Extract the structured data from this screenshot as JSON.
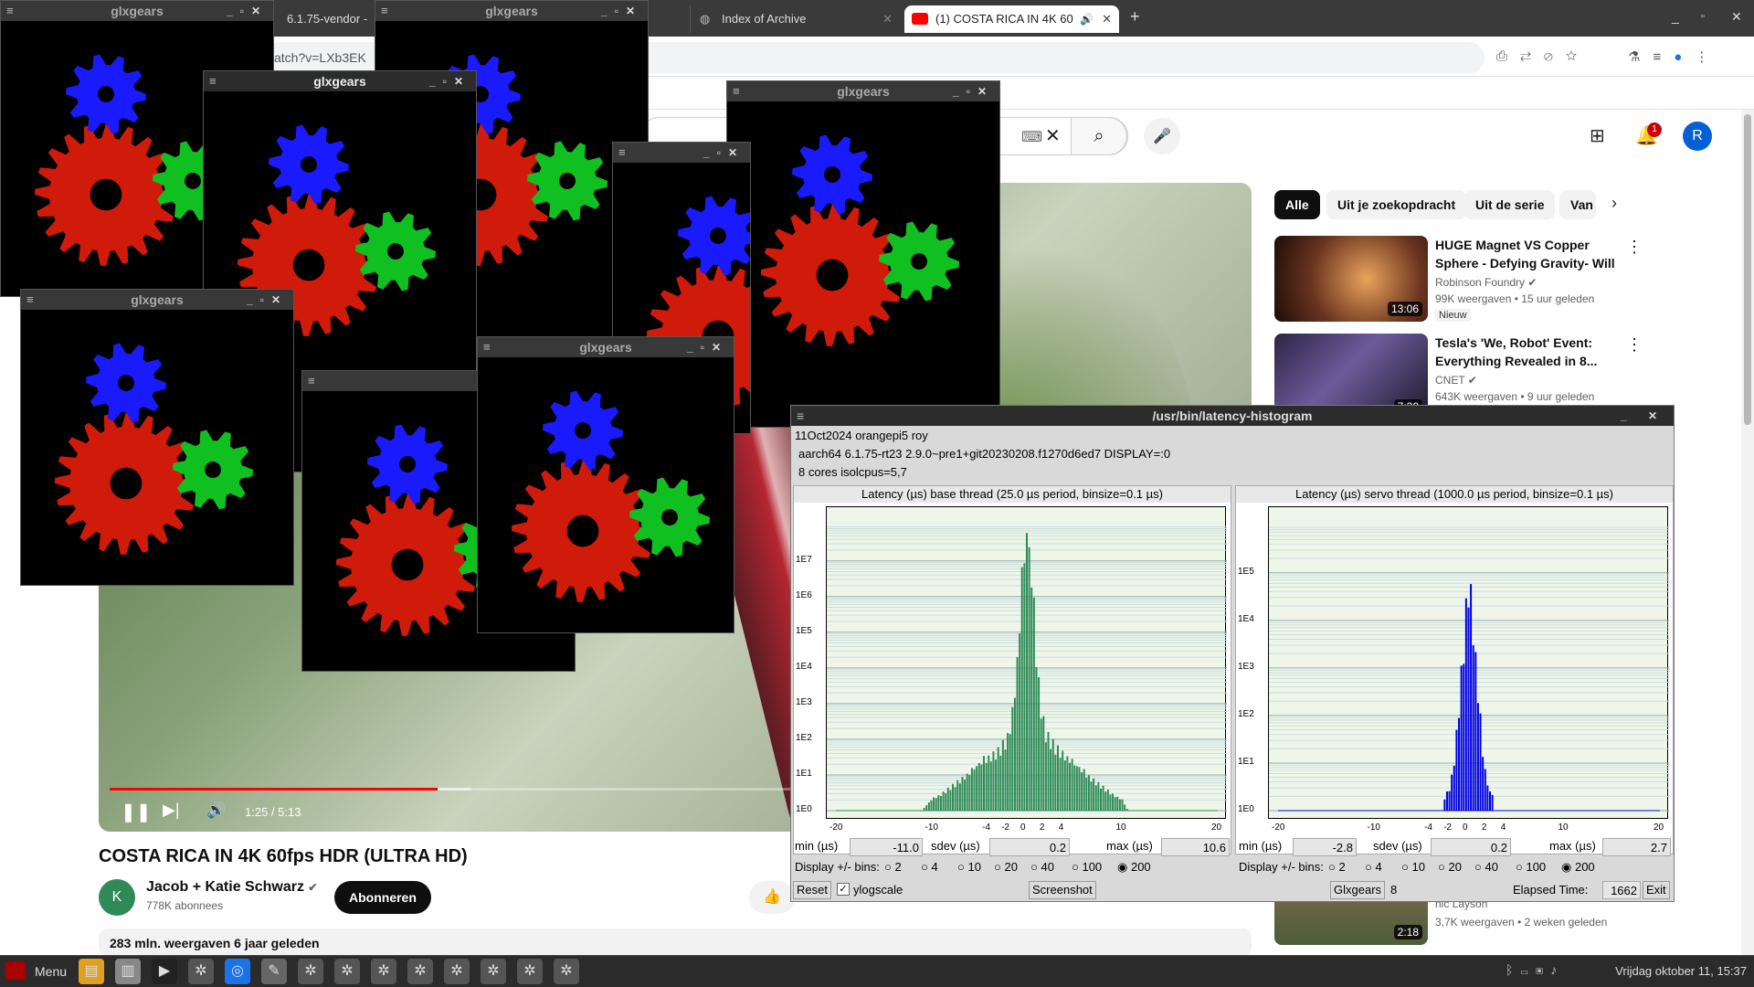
{
  "browser": {
    "tabs": [
      {
        "label": "6.1.75-vendor - G",
        "active": false
      },
      {
        "label": "Index of Archive",
        "active": false
      },
      {
        "label": "(1) COSTA RICA IN 4K 60",
        "active": true
      }
    ],
    "url": "atch?v=LXb3EK"
  },
  "youtube": {
    "filter_pills": [
      "Alle",
      "Uit je zoekopdracht",
      "Uit de serie",
      "Van"
    ],
    "video": {
      "title": "COSTA RICA IN 4K 60fps HDR (ULTRA HD)",
      "time": "1:25 / 5:13",
      "progress_fraction": 0.29,
      "buffered_fraction": 0.32
    },
    "channel": {
      "name": "Jacob + Katie Schwarz",
      "subs": "778K abonnees",
      "avatar_initial": "K",
      "subscribe_label": "Abonneren"
    },
    "description": "283 mln. weergaven  6 jaar geleden",
    "notification_count": "1",
    "avatar_letter": "R",
    "recommendations": [
      {
        "title": "HUGE Magnet VS Copper Sphere - Defying Gravity- Will ...",
        "channel": "Robinson Foundry",
        "meta": "99K weergaven  • 15 uur geleden",
        "badge": "Nieuw",
        "duration": "13:06"
      },
      {
        "title": "Tesla's 'We, Robot' Event: Everything Revealed in 8...",
        "channel": "CNET",
        "meta": "643K weergaven  • 9 uur geleden",
        "badge": "",
        "duration": "7:30"
      },
      {
        "title": "",
        "channel": "nic Layson",
        "meta": "3,7K weergaven  • 2 weken geleden",
        "badge": "",
        "duration": "2:18"
      }
    ]
  },
  "glxgears": {
    "title": "glxgears",
    "partial_title": "glxgear"
  },
  "latency": {
    "window_title": "/usr/bin/latency-histogram",
    "info_line1": "11Oct2024 orangepi5 roy",
    "info_line2": "aarch64  6.1.75-rt23  2.9.0~pre1+git20230208.f1270d6ed7  DISPLAY=:0",
    "info_line3": "8 cores  isolcpus=5,7",
    "labels": {
      "min": "min (µs)",
      "sdev": "sdev (µs)",
      "max": "max (µs)",
      "bins": "Display +/- bins:"
    },
    "bin_options": [
      "2",
      "4",
      "10",
      "20",
      "40",
      "100",
      "200"
    ],
    "selected_bins": "200",
    "base": {
      "title": "Latency (µs) base thread (25.0 µs period, binsize=0.1 µs)",
      "min": "-11.0",
      "sdev": "0.2",
      "max": "10.6",
      "color": "#2e8b57"
    },
    "servo": {
      "title": "Latency (µs) servo thread (1000.0 µs period, binsize=0.1 µs)",
      "min": "-2.8",
      "sdev": "0.2",
      "max": "2.7",
      "color": "#0000e0"
    },
    "buttons": {
      "reset": "Reset",
      "ylogscale": "ylogscale",
      "screenshot": "Screenshot",
      "glxgears": "Glxgears",
      "glxgears_count": "8",
      "elapsed_label": "Elapsed Time:",
      "elapsed_value": "1662",
      "exit": "Exit"
    }
  },
  "chart_data": [
    {
      "type": "bar",
      "title": "Latency (µs) base thread (25.0 µs period, binsize=0.1 µs)",
      "xlabel": "",
      "ylabel": "",
      "xlim": [
        -20,
        20
      ],
      "y_scale": "log",
      "ylim": [
        1,
        100000000
      ],
      "x_ticks": [
        -20,
        -10,
        -4,
        -2,
        0,
        2,
        4,
        10,
        20
      ],
      "y_ticks": [
        "1E0",
        "1E1",
        "1E2",
        "1E3",
        "1E4",
        "1E5",
        "1E6",
        "1E7"
      ],
      "series": [
        {
          "x": [
            -11,
            -10,
            -9,
            -8,
            -7,
            -6,
            -5,
            -4,
            -3,
            -2,
            -1.5,
            -1,
            -0.5,
            0,
            0.5,
            1,
            1.5,
            2,
            3,
            4,
            5,
            6,
            7,
            8,
            9,
            10,
            10.6
          ],
          "values": [
            1,
            2,
            3,
            5,
            8,
            12,
            20,
            35,
            60,
            150,
            800,
            20000,
            3000000,
            60000000,
            4000000,
            30000,
            1000,
            200,
            80,
            40,
            20,
            12,
            8,
            5,
            3,
            2,
            1
          ]
        }
      ]
    },
    {
      "type": "bar",
      "title": "Latency (µs) servo thread (1000.0 µs period, binsize=0.1 µs)",
      "xlabel": "",
      "ylabel": "",
      "xlim": [
        -20,
        20
      ],
      "y_scale": "log",
      "ylim": [
        1,
        1000000
      ],
      "x_ticks": [
        -20,
        -10,
        -4,
        -2,
        0,
        2,
        4,
        10,
        20
      ],
      "y_ticks": [
        "1E0",
        "1E1",
        "1E2",
        "1E3",
        "1E4",
        "1E5"
      ],
      "series": [
        {
          "x": [
            -2.8,
            -2.5,
            -2,
            -1.5,
            -1,
            -0.5,
            0,
            0.5,
            1,
            1.5,
            2,
            2.5,
            2.7
          ],
          "values": [
            1,
            2,
            3,
            15,
            300,
            8000,
            200000,
            9000,
            250,
            12,
            3,
            2,
            1
          ]
        }
      ]
    }
  ],
  "taskbar": {
    "menu_label": "Menu",
    "clock": "Vrijdag oktober 11, 15:37"
  }
}
